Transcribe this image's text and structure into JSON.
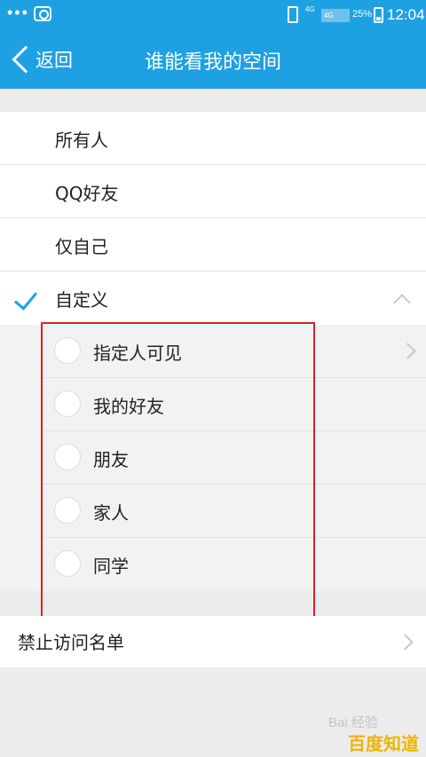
{
  "status": {
    "dots": "•••",
    "network_1": "4G",
    "network_2": "4G",
    "battery": "25%",
    "time": "12:04"
  },
  "header": {
    "back_label": "返回",
    "title": "谁能看我的空间",
    "color": "#1ea1e2"
  },
  "options": [
    {
      "label": "所有人",
      "selected": false
    },
    {
      "label": "QQ好友",
      "selected": false
    },
    {
      "label": "仅自己",
      "selected": false
    },
    {
      "label": "自定义",
      "selected": true
    }
  ],
  "custom_options": [
    {
      "label": "指定人可见"
    },
    {
      "label": "我的好友"
    },
    {
      "label": "朋友"
    },
    {
      "label": "家人"
    },
    {
      "label": "同学"
    }
  ],
  "blacklist": {
    "label": "禁止访问名单"
  },
  "watermark": {
    "brand": "百度知道",
    "latin": "Bai 经验"
  },
  "icons": [
    "camera-icon",
    "phone-icon",
    "battery-icon",
    "back-chevron-icon",
    "check-icon",
    "chevron-up-icon",
    "chevron-right-icon"
  ]
}
